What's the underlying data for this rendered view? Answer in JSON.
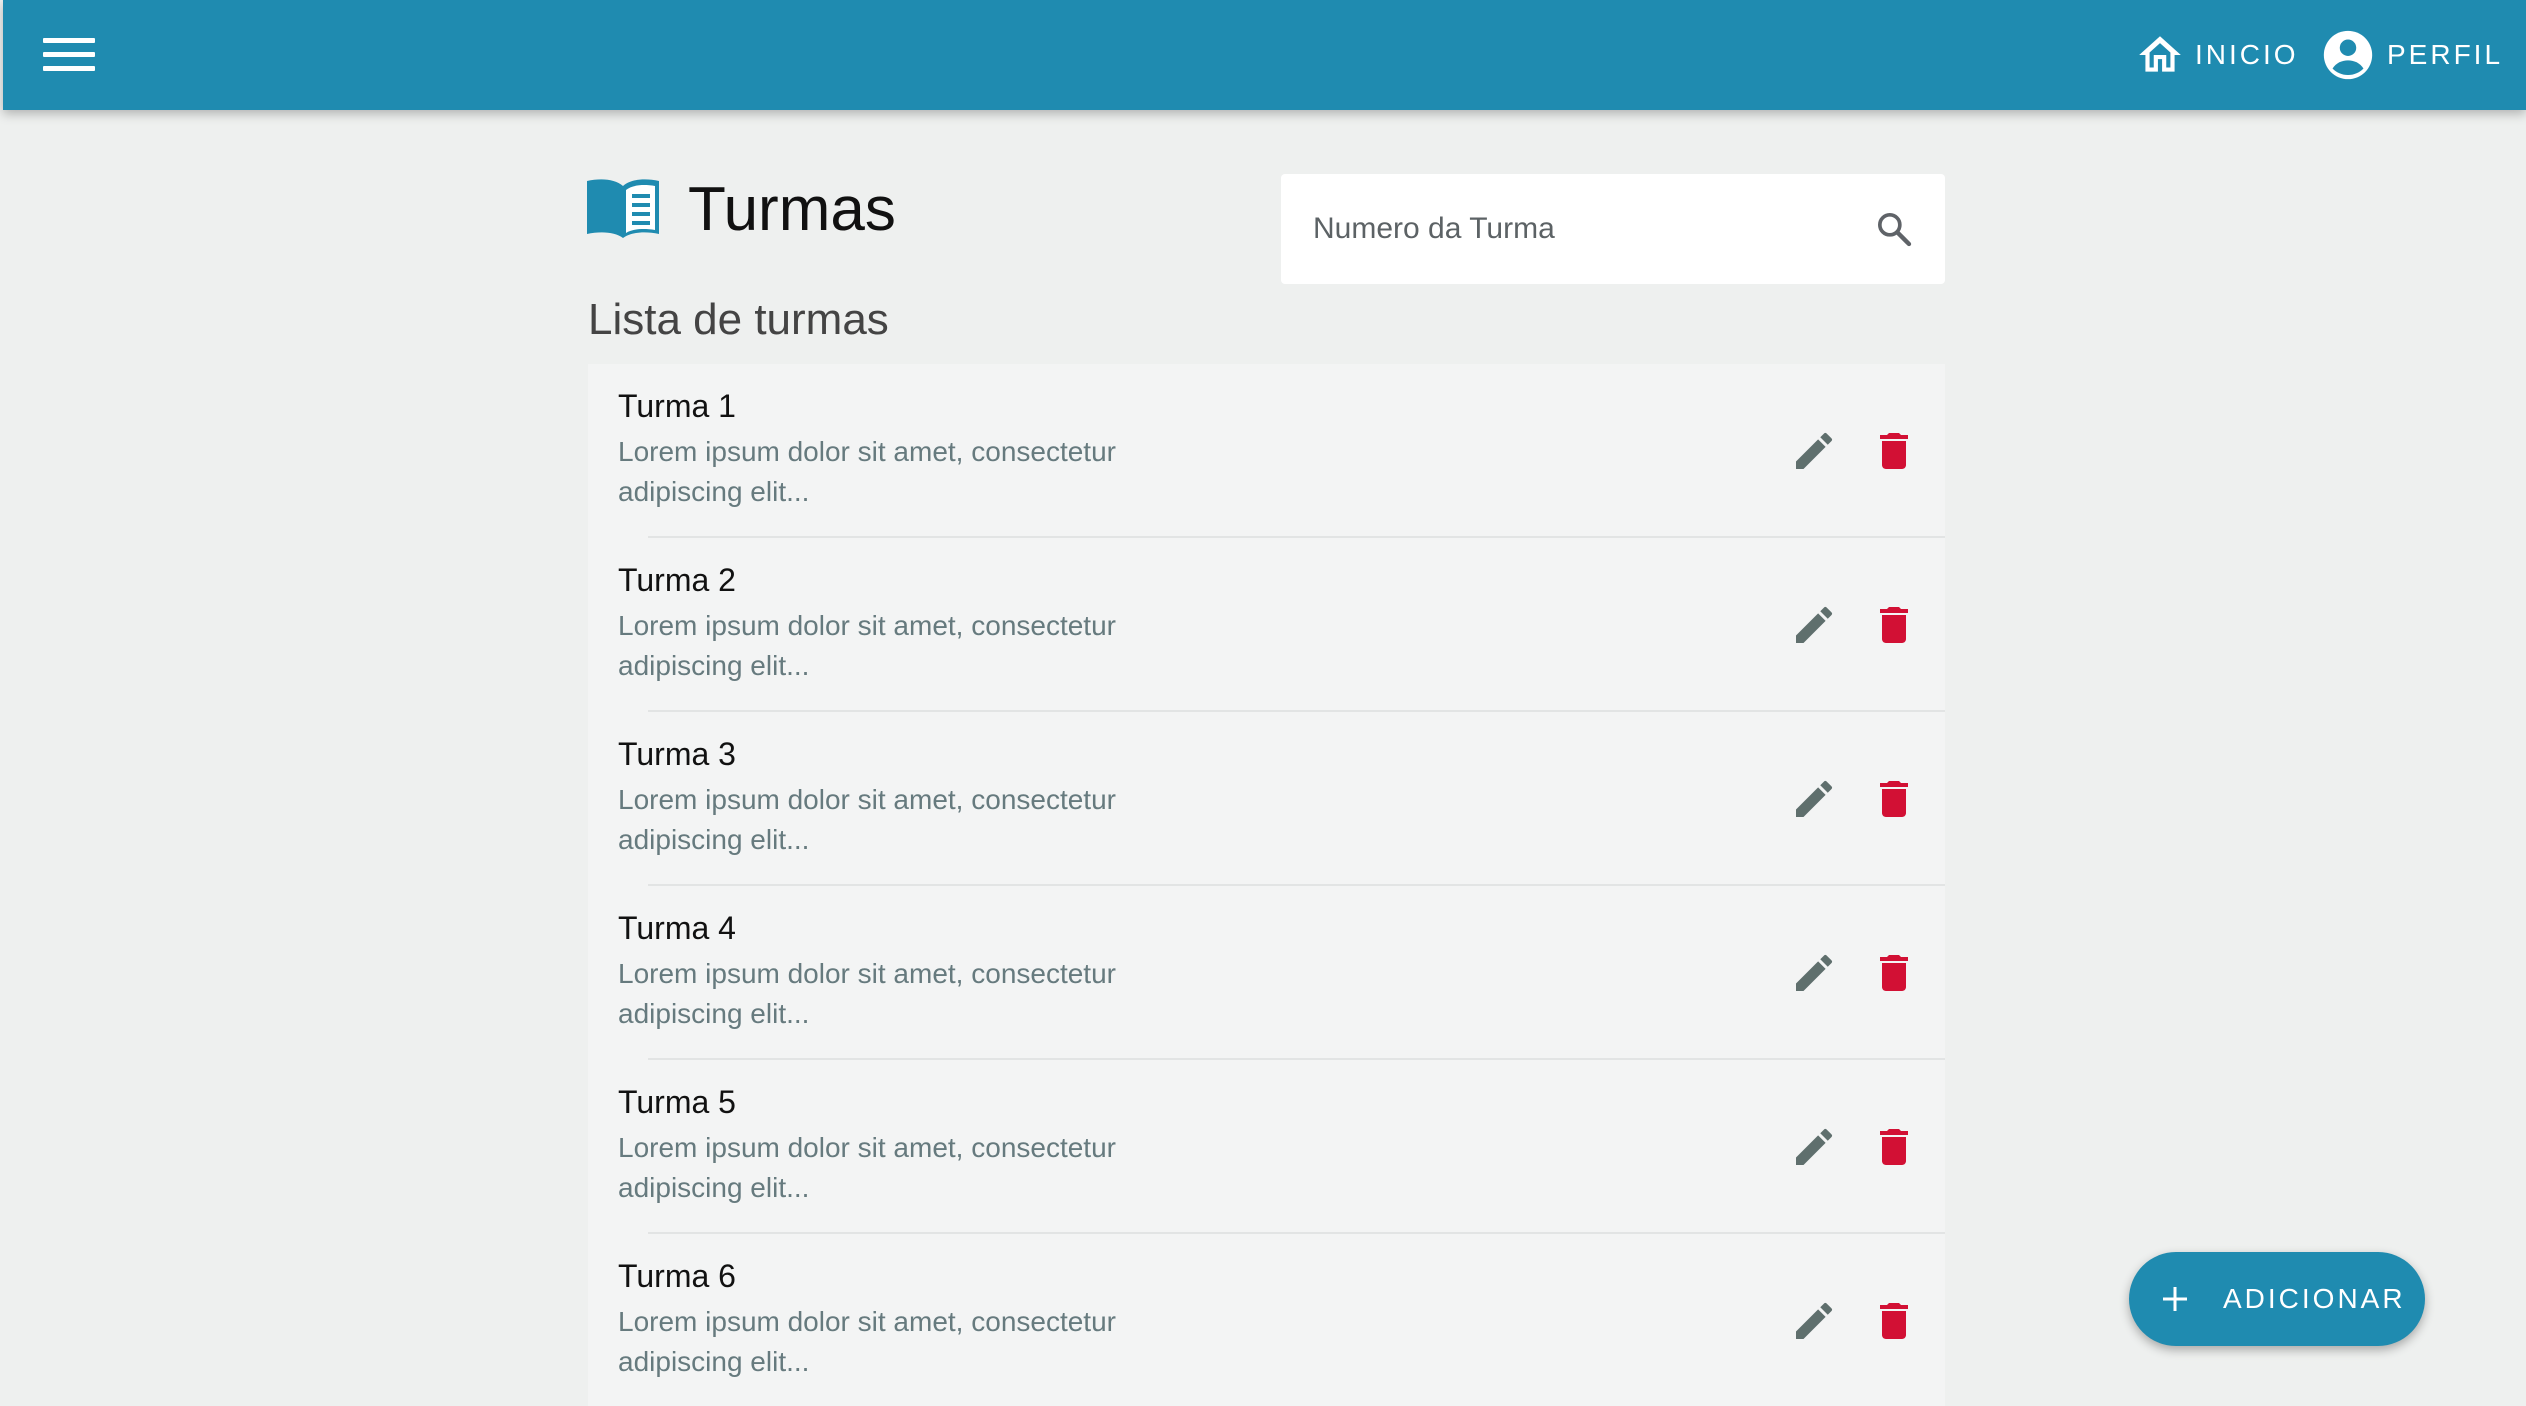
{
  "colors": {
    "primary": "#1f8bb0",
    "background": "#eef0ef",
    "list_background": "#f3f4f4",
    "edit_icon": "#5f6f6d",
    "delete_icon": "#d21034",
    "description_text": "#667a7e"
  },
  "appbar": {
    "menu_icon": "hamburger-menu-icon",
    "nav": [
      {
        "label": "INICIO",
        "icon": "home-icon"
      },
      {
        "label": "PERFIL",
        "icon": "account-circle-icon"
      }
    ]
  },
  "page": {
    "title": "Turmas",
    "title_icon": "open-book-icon",
    "subtitle": "Lista de turmas"
  },
  "search": {
    "placeholder": "Numero da Turma",
    "value": "",
    "icon": "search-icon"
  },
  "list": {
    "items": [
      {
        "title": "Turma 1",
        "description": "Lorem ipsum dolor sit amet, consectetur adipiscing elit..."
      },
      {
        "title": "Turma 2",
        "description": "Lorem ipsum dolor sit amet, consectetur adipiscing elit..."
      },
      {
        "title": "Turma 3",
        "description": "Lorem ipsum dolor sit amet, consectetur adipiscing elit..."
      },
      {
        "title": "Turma 4",
        "description": "Lorem ipsum dolor sit amet, consectetur adipiscing elit..."
      },
      {
        "title": "Turma 5",
        "description": "Lorem ipsum dolor sit amet, consectetur adipiscing elit..."
      },
      {
        "title": "Turma 6",
        "description": "Lorem ipsum dolor sit amet, consectetur adipiscing elit..."
      }
    ],
    "item_actions": [
      {
        "icon": "pencil-edit-icon"
      },
      {
        "icon": "trash-delete-icon"
      }
    ]
  },
  "fab": {
    "label": "ADICIONAR",
    "icon": "plus-icon"
  }
}
